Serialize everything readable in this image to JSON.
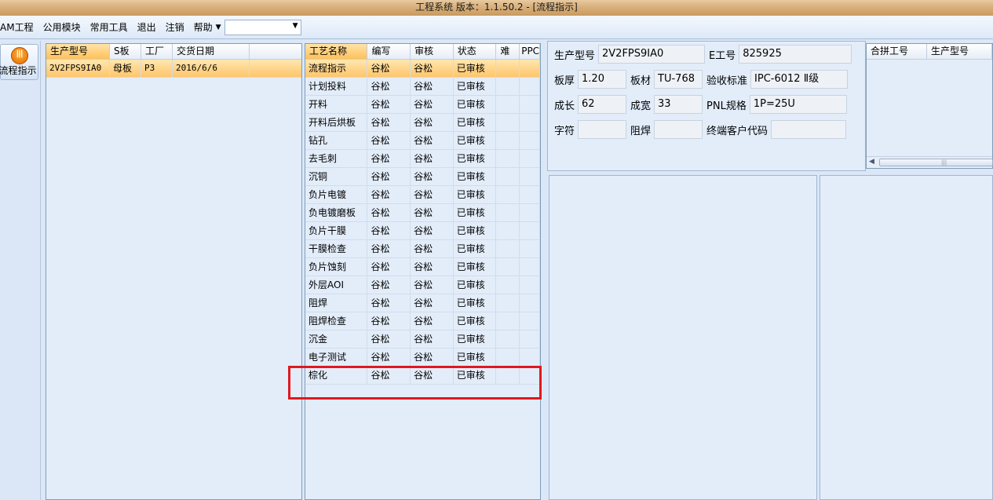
{
  "window": {
    "title": "工程系统   版本：1.1.50.2 - [流程指示]"
  },
  "menu": {
    "items": [
      "AM工程",
      "公用模块",
      "常用工具",
      "退出",
      "注销",
      "帮助"
    ],
    "combo_value": ""
  },
  "nav": {
    "flow_button_label": "流程指示"
  },
  "order_grid": {
    "headers": [
      "生产型号",
      "S板",
      "工厂",
      "交货日期"
    ],
    "rows": [
      [
        "2V2FPS9IA0",
        "母板",
        "P3",
        "2016/6/6"
      ]
    ]
  },
  "process_grid": {
    "headers": [
      "工艺名称",
      "编写",
      "审核",
      "状态",
      "难",
      "PPC"
    ],
    "rows": [
      [
        "流程指示",
        "谷松",
        "谷松",
        "已审核",
        "",
        ""
      ],
      [
        "计划投料",
        "谷松",
        "谷松",
        "已审核",
        "",
        ""
      ],
      [
        "开料",
        "谷松",
        "谷松",
        "已审核",
        "",
        ""
      ],
      [
        "开料后烘板",
        "谷松",
        "谷松",
        "已审核",
        "",
        ""
      ],
      [
        "钻孔",
        "谷松",
        "谷松",
        "已审核",
        "",
        ""
      ],
      [
        "去毛刺",
        "谷松",
        "谷松",
        "已审核",
        "",
        ""
      ],
      [
        "沉铜",
        "谷松",
        "谷松",
        "已审核",
        "",
        ""
      ],
      [
        "负片电镀",
        "谷松",
        "谷松",
        "已审核",
        "",
        ""
      ],
      [
        "负电镀磨板",
        "谷松",
        "谷松",
        "已审核",
        "",
        ""
      ],
      [
        "负片干膜",
        "谷松",
        "谷松",
        "已审核",
        "",
        ""
      ],
      [
        "干膜检查",
        "谷松",
        "谷松",
        "已审核",
        "",
        ""
      ],
      [
        "负片蚀刻",
        "谷松",
        "谷松",
        "已审核",
        "",
        ""
      ],
      [
        "外层AOI",
        "谷松",
        "谷松",
        "已审核",
        "",
        ""
      ],
      [
        "阻焊",
        "谷松",
        "谷松",
        "已审核",
        "",
        ""
      ],
      [
        "阻焊检查",
        "谷松",
        "谷松",
        "已审核",
        "",
        ""
      ],
      [
        "沉金",
        "谷松",
        "谷松",
        "已审核",
        "",
        ""
      ],
      [
        "电子测试",
        "谷松",
        "谷松",
        "已审核",
        "",
        ""
      ],
      [
        "棕化",
        "谷松",
        "谷松",
        "已审核",
        "",
        ""
      ]
    ]
  },
  "info": {
    "model_label": "生产型号",
    "model_value": "2V2FPS9IA0",
    "eno_label": "E工号",
    "eno_value": "825925",
    "thickness_label": "板厚",
    "thickness_value": "1.20",
    "material_label": "板材",
    "material_value": "TU-768",
    "standard_label": "验收标准",
    "standard_value": "IPC-6012 Ⅱ级",
    "length_label": "成长",
    "length_value": "62",
    "width_label": "成宽",
    "width_value": "33",
    "pnl_label": "PNL规格",
    "pnl_value": "1P=25U",
    "char_label": "字符",
    "char_value": "",
    "mask_label": "阻焊",
    "mask_value": "",
    "customer_label": "终端客户代码",
    "customer_value": ""
  },
  "merge_grid": {
    "headers": [
      "合拼工号",
      "生产型号"
    ]
  },
  "colors": {
    "selected_row": "#ffc56a",
    "highlight_box": "#e0191e",
    "title_bar": "#d8b07c"
  }
}
